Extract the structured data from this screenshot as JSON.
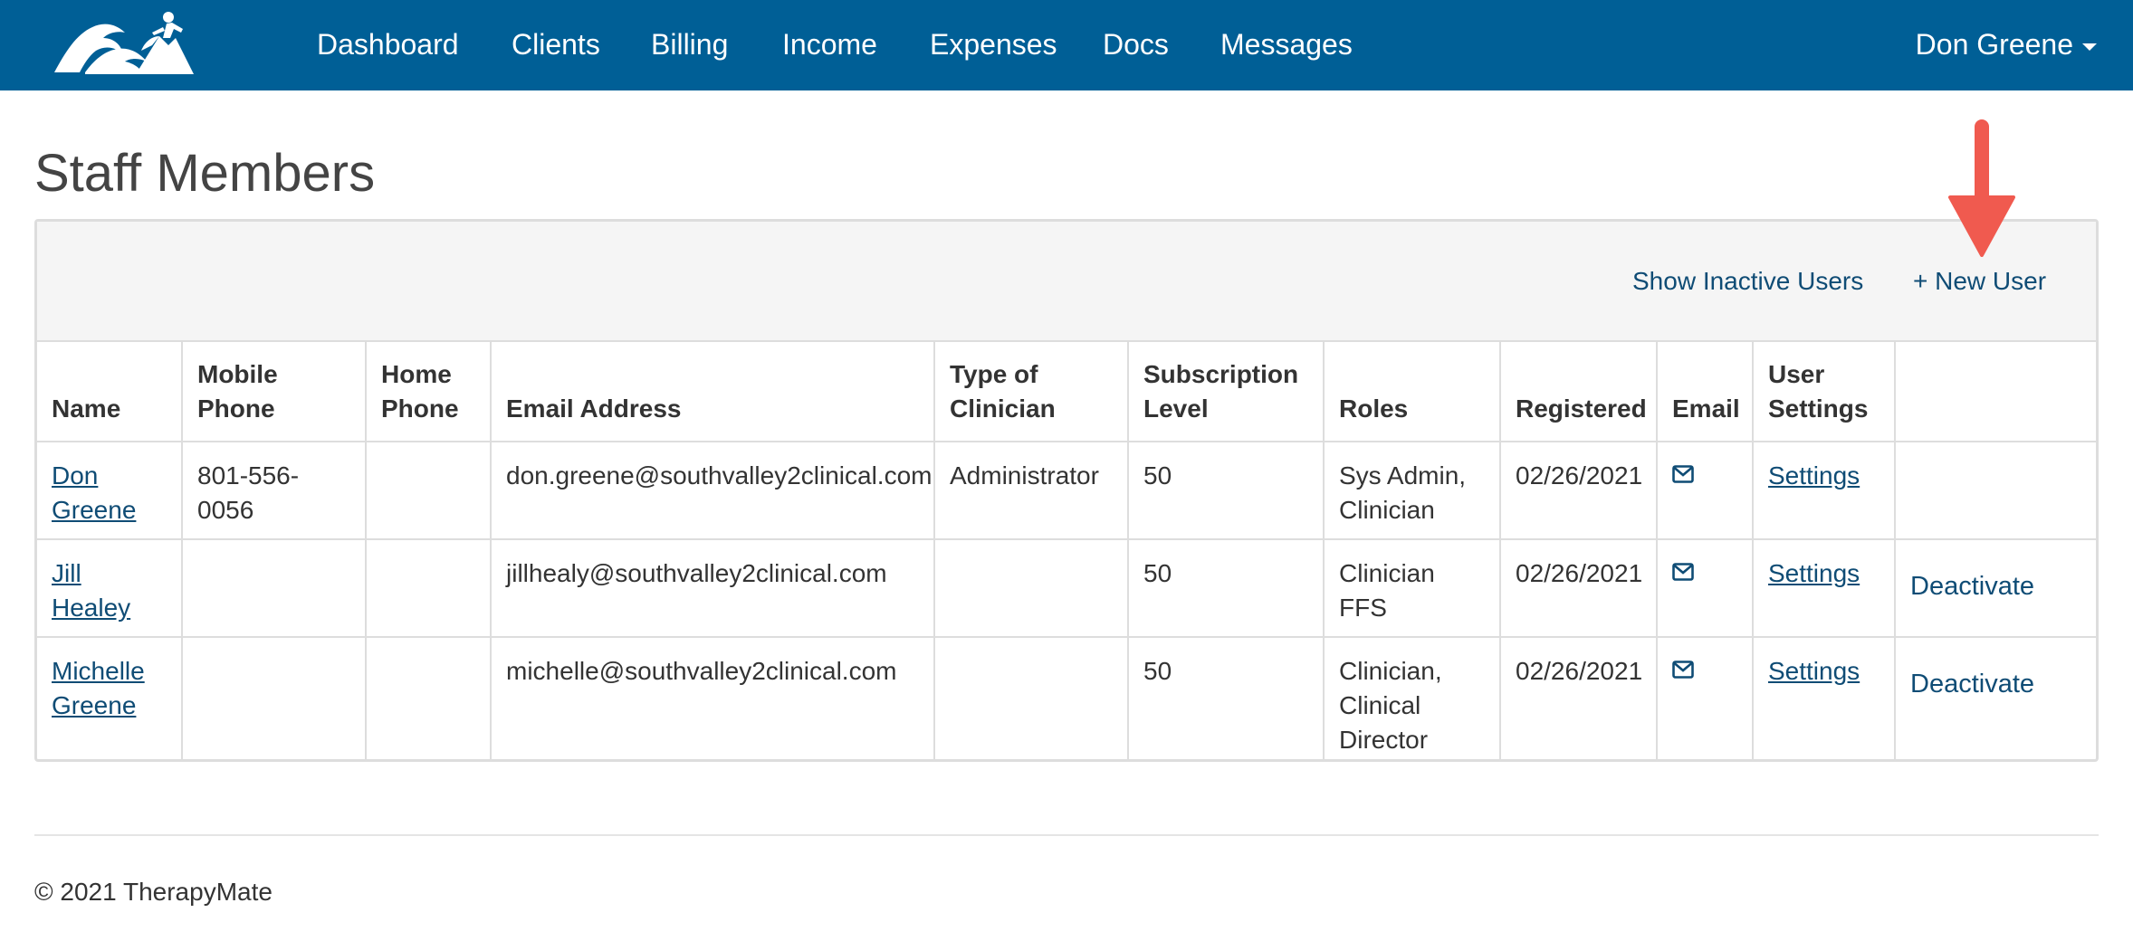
{
  "nav": {
    "items": [
      {
        "label": "Dashboard"
      },
      {
        "label": "Clients"
      },
      {
        "label": "Billing"
      },
      {
        "label": "Income"
      },
      {
        "label": "Expenses"
      },
      {
        "label": "Docs"
      },
      {
        "label": "Messages"
      }
    ],
    "user": "Don Greene",
    "logo_icon": "mountain-climber-logo"
  },
  "page": {
    "title": "Staff Members"
  },
  "panel": {
    "show_inactive_label": "Show Inactive Users",
    "new_user_label": "+ New User"
  },
  "table": {
    "headers": [
      {
        "line1": "",
        "line2": "Name"
      },
      {
        "line1": "Mobile",
        "line2": "Phone"
      },
      {
        "line1": "Home",
        "line2": "Phone"
      },
      {
        "line1": "",
        "line2": "Email Address"
      },
      {
        "line1": "Type of",
        "line2": "Clinician"
      },
      {
        "line1": "Subscription",
        "line2": "Level"
      },
      {
        "line1": "",
        "line2": "Roles"
      },
      {
        "line1": "",
        "line2": "Registered"
      },
      {
        "line1": "",
        "line2": "Email"
      },
      {
        "line1": "User",
        "line2": "Settings"
      },
      {
        "line1": "",
        "line2": ""
      }
    ],
    "rows": [
      {
        "name_first": "Don",
        "name_last": "Greene",
        "mobile": "801-556-0056",
        "home": "",
        "email": "don.greene@southvalley2clinical.com",
        "clinician_type": "Administrator",
        "subscription": "50",
        "roles": [
          "Sys Admin,",
          "Clinician"
        ],
        "registered": "02/26/2021",
        "settings": "Settings",
        "action": ""
      },
      {
        "name_first": "Jill Healey",
        "name_last": "",
        "mobile": "",
        "home": "",
        "email": "jillhealy@southvalley2clinical.com",
        "clinician_type": "",
        "subscription": "50",
        "roles": [
          "Clinician FFS"
        ],
        "registered": "02/26/2021",
        "settings": "Settings",
        "action": "Deactivate"
      },
      {
        "name_first": "Michelle",
        "name_last": "Greene",
        "mobile": "",
        "home": "",
        "email": "michelle@southvalley2clinical.com",
        "clinician_type": "",
        "subscription": "50",
        "roles": [
          "Clinician,",
          "Clinical",
          "Director"
        ],
        "registered": "02/26/2021",
        "settings": "Settings",
        "action": "Deactivate"
      }
    ],
    "email_icon": "envelope-icon"
  },
  "footer": {
    "copyright": "© 2021 TherapyMate"
  },
  "colors": {
    "navbar": "#005f96",
    "link": "#0f4c75",
    "annotation_arrow": "#f05a4f",
    "panel_head_bg": "#f5f5f5",
    "border": "#dddddd"
  }
}
